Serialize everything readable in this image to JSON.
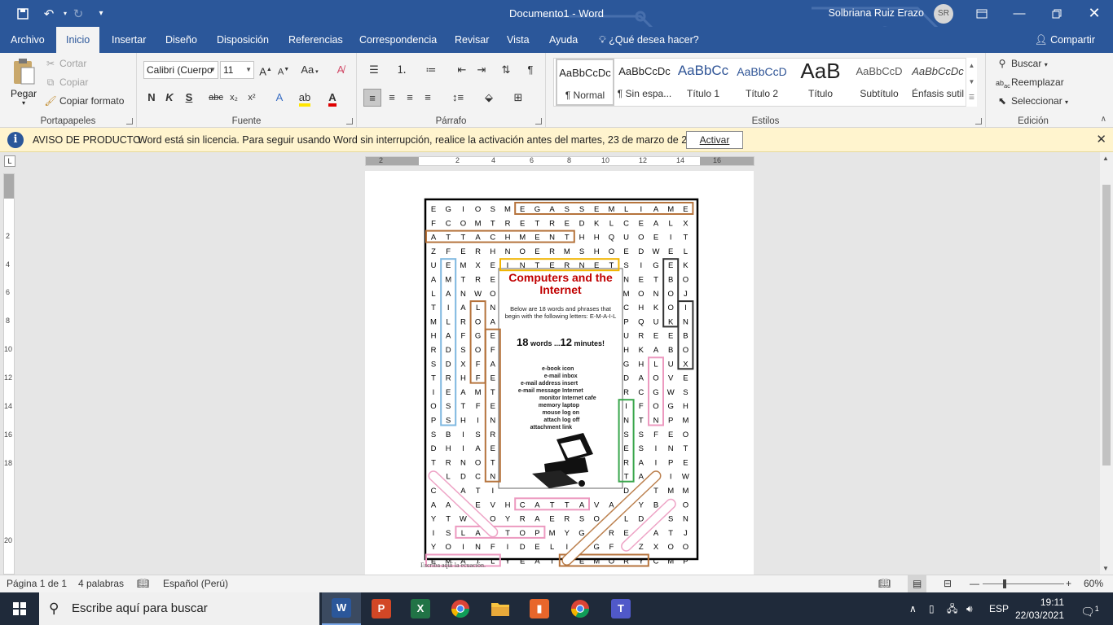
{
  "window": {
    "title": "Documento1  -  Word",
    "user_name": "Solbriana Ruiz Erazo",
    "user_initials": "SR"
  },
  "tabs": [
    "Archivo",
    "Inicio",
    "Insertar",
    "Diseño",
    "Disposición",
    "Referencias",
    "Correspondencia",
    "Revisar",
    "Vista",
    "Ayuda"
  ],
  "tell_me": "¿Qué desea hacer?",
  "share": "Compartir",
  "ribbon": {
    "clipboard": {
      "paste": "Pegar",
      "cut": "Cortar",
      "copy": "Copiar",
      "format_painter": "Copiar formato",
      "label": "Portapapeles"
    },
    "font": {
      "name": "Calibri (Cuerpo",
      "size": "11",
      "label": "Fuente",
      "case": "Aa",
      "bold": "N",
      "italic": "K",
      "underline": "S",
      "strike": "abc"
    },
    "paragraph": {
      "label": "Párrafo"
    },
    "styles": {
      "label": "Estilos",
      "items": [
        {
          "preview": "AaBbCcDc",
          "name": "¶ Normal",
          "color": "#000000"
        },
        {
          "preview": "AaBbCcDc",
          "name": "¶ Sin espa...",
          "color": "#000000"
        },
        {
          "preview": "AaBbCc",
          "name": "Título 1",
          "color": "#2f5496"
        },
        {
          "preview": "AaBbCcD",
          "name": "Título 2",
          "color": "#2f5496"
        },
        {
          "preview": "AaB",
          "name": "Título",
          "color": "#000000"
        },
        {
          "preview": "AaBbCcD",
          "name": "Subtítulo",
          "color": "#595959"
        },
        {
          "preview": "AaBbCcDc",
          "name": "Énfasis sutil",
          "color": "#404040"
        }
      ]
    },
    "editing": {
      "label": "Edición",
      "find": "Buscar",
      "replace": "Reemplazar",
      "select": "Seleccionar"
    }
  },
  "notice": {
    "title": "AVISO DE PRODUCTO",
    "message": "Word está sin licencia. Para seguir usando Word sin interrupción, realice la activación antes del martes, 23 de marzo de 2021.",
    "button": "Activar"
  },
  "ruler": {
    "h_numbers": [
      "2",
      "2",
      "4",
      "6",
      "8",
      "10",
      "12",
      "14",
      "16"
    ],
    "v_numbers": [
      "2",
      "4",
      "6",
      "8",
      "10",
      "12",
      "14",
      "16",
      "18",
      "20"
    ]
  },
  "document": {
    "grid": [
      "EGIOSMEGASSEMLIAME",
      "FCOMTRETREDKLCEALX",
      "ATTACHMENTHHQUOEIT",
      "ZFERHNOERMSHOEDWEL",
      "UEMXEINTERNETSIGEK",
      "AMTRE        NETBO",
      "LANWO        MONOJ",
      "TIALN        CHKOI",
      "MLROA        PQUKN",
      "HAFGE        UREEB",
      "RDSOF        HKABO",
      "SDXFA        GHLUX",
      "TRHFE        DAOVE",
      "IEAMT        RCGWS",
      "OSTFE        IFOGH",
      "PSHIN        NTNPM",
      "SBISR        SSFEO",
      "DHIAE        ESINT",
      "TRNOT        RAIPE",
      "ILDCN        TARIW",
      "CCATI        DOTMM",
      "AAOEVHCATTAVATYBKO",
      "YTWNOYRAERSOILDNSN",
      "ISLAPTOPMYGNREIATJ",
      "YOINFIDELIOGFLZXOO",
      "EMAILYEAIMEMORYCMP"
    ],
    "panel_title": "Computers and the Internet",
    "panel_intro": "Below are 18 words and phrases that begin with the following letters:  E-M-A-I-L",
    "panel_count_a": "18",
    "panel_count_b": "words ...",
    "panel_count_c": "12",
    "panel_count_d": "minutes!",
    "words_left": [
      "e-book",
      "e-mail",
      "e-mail address",
      "e-mail message",
      "monitor",
      "memory",
      "mouse",
      "attach",
      "attachment"
    ],
    "words_right": [
      "icon",
      "inbox",
      "insert",
      "Internet",
      "Internet cafe",
      "laptop",
      "log on",
      "log off",
      "link"
    ],
    "equation_hint": "Escriba aquí la ecuación."
  },
  "status": {
    "page": "Página 1 de 1",
    "words": "4 palabras",
    "language": "Español (Perú)",
    "zoom": "60%"
  },
  "taskbar": {
    "search": "Escribe aquí para buscar",
    "language": "ESP",
    "time": "19:11",
    "date": "22/03/2021",
    "notifications": "1"
  }
}
